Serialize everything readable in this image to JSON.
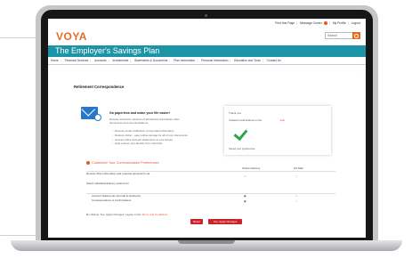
{
  "utility_nav": {
    "links": [
      "Print this Page",
      "Message Center",
      "My Profile",
      "Logout"
    ]
  },
  "header": {
    "logo": "VOYA",
    "search_placeholder": "Search",
    "plan_title": "The Employer's Savings Plan"
  },
  "nav": {
    "items": [
      "Home",
      "Financial Services",
      "Accounts",
      "Investments",
      "Statements & Documents",
      "Plan Information",
      "Personal Information",
      "Education and Tools",
      "Contact Us"
    ]
  },
  "page": {
    "section_title": "Retirement Correspondence",
    "intro_heading": "Go paperless and make your life easier!",
    "intro_text": "Receive electronic versions of all Defined Contribution plan documents and communications.",
    "bullets": [
      "Receive email notification of important information",
      "Reduce clutter - easy online storage for all of your documents",
      "Access online account statements at your leisure",
      "Help protect your identity from mail theft"
    ]
  },
  "confirm_card": {
    "line1": "Thank you",
    "line2": "Updated email address on file",
    "link": "Edit",
    "footer": "Saved your preferences"
  },
  "preferences": {
    "link": "Customize Your Communication Preferences",
    "col_headers": [
      "Online Delivery",
      "US Mail"
    ],
    "rows": [
      {
        "label": "Receive Plan information and required documents via",
        "online": "",
        "mail": ""
      },
      {
        "label": "",
        "online": "",
        "mail": ""
      },
      {
        "label": "Select individual delivery options for",
        "online": "",
        "mail": ""
      },
      {
        "label": "Account Statements (Annual & Quarterly)",
        "online": "",
        "mail": ""
      },
      {
        "label": "Correspondence & Confirmations",
        "online": "",
        "mail": ""
      }
    ],
    "footnote": "By clicking 'Yes, Apply Changes' I agree to the",
    "footnote_link": "Terms and Conditions",
    "reset_label": "Reset",
    "apply_label": "Yes, Apply Changes"
  },
  "colors": {
    "brand_orange": "#e86c1f",
    "banner_teal": "#1d94a5",
    "button_red": "#c8242c",
    "success_green": "#2ca44e"
  }
}
